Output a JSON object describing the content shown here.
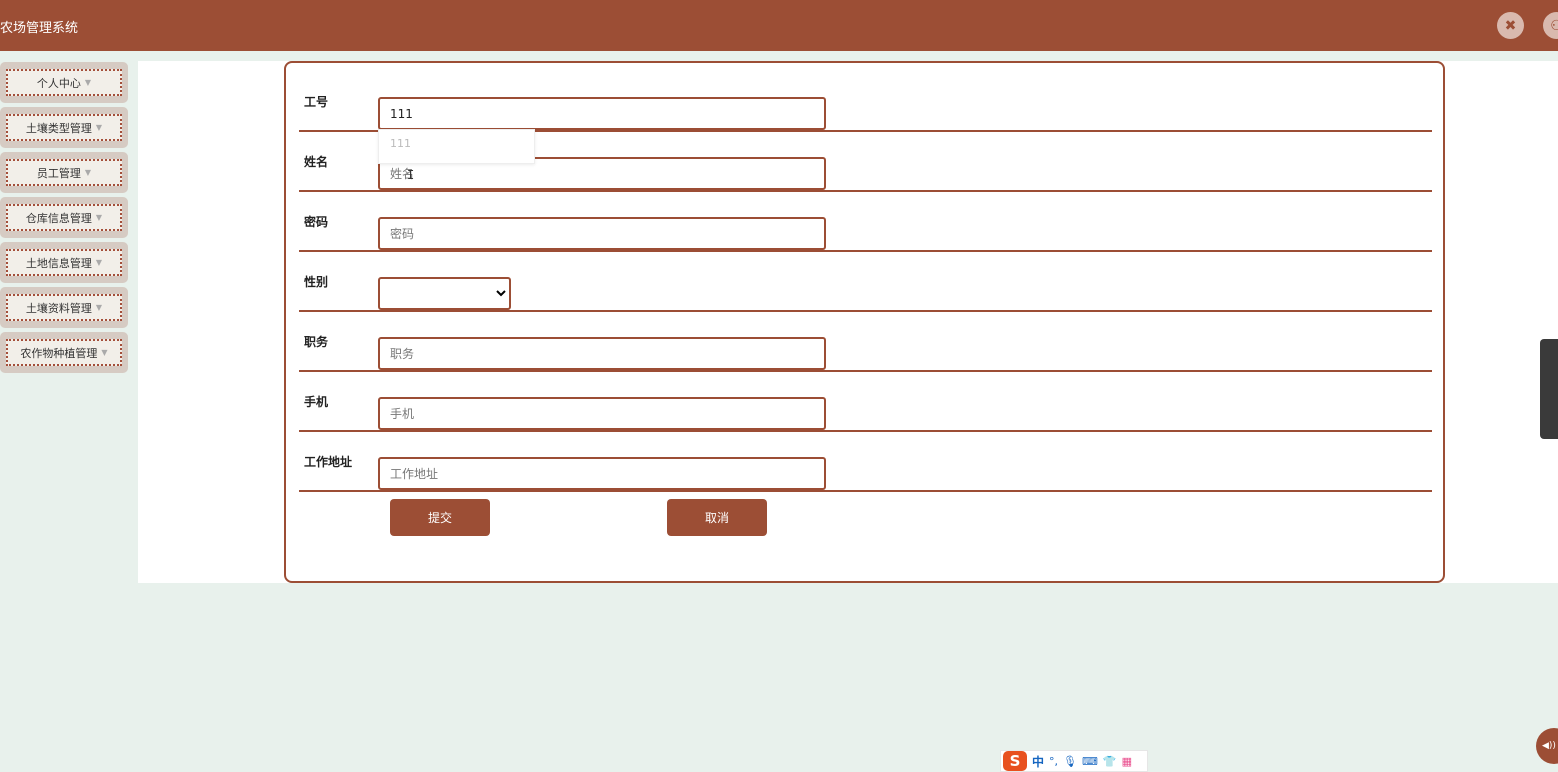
{
  "header": {
    "title": "农场管理系统",
    "fullscreen_icon": "✖",
    "user_icon": "⚇"
  },
  "sidebar": {
    "items": [
      {
        "label": "个人中心"
      },
      {
        "label": "土壤类型管理"
      },
      {
        "label": "员工管理"
      },
      {
        "label": "仓库信息管理"
      },
      {
        "label": "土地信息管理"
      },
      {
        "label": "土壤资料管理"
      },
      {
        "label": "农作物种植管理"
      }
    ],
    "caret": "▼"
  },
  "form": {
    "employee_id": {
      "label": "工号",
      "value": "111",
      "placeholder": "工号"
    },
    "name": {
      "label": "姓名",
      "value": "",
      "placeholder": "姓名"
    },
    "password": {
      "label": "密码",
      "value": "",
      "placeholder": "密码"
    },
    "gender": {
      "label": "性别",
      "selected": ""
    },
    "position": {
      "label": "职务",
      "value": "",
      "placeholder": "职务"
    },
    "phone": {
      "label": "手机",
      "value": "",
      "placeholder": "手机"
    },
    "address": {
      "label": "工作地址",
      "value": "",
      "placeholder": "工作地址"
    },
    "autocomplete_suggestion": "111",
    "submit_label": "提交",
    "cancel_label": "取消"
  },
  "ime": {
    "logo": "S",
    "mode": "中",
    "punct": "°,",
    "mic": "🎙",
    "keyboard": "⌨",
    "skin": "👕",
    "apps": "▦"
  },
  "floating": {
    "label": "◀))"
  },
  "colors": {
    "brand": "#9c4e35",
    "page_bg": "#e8f1ec",
    "sidebar_item_bg": "#d6cbc3"
  }
}
